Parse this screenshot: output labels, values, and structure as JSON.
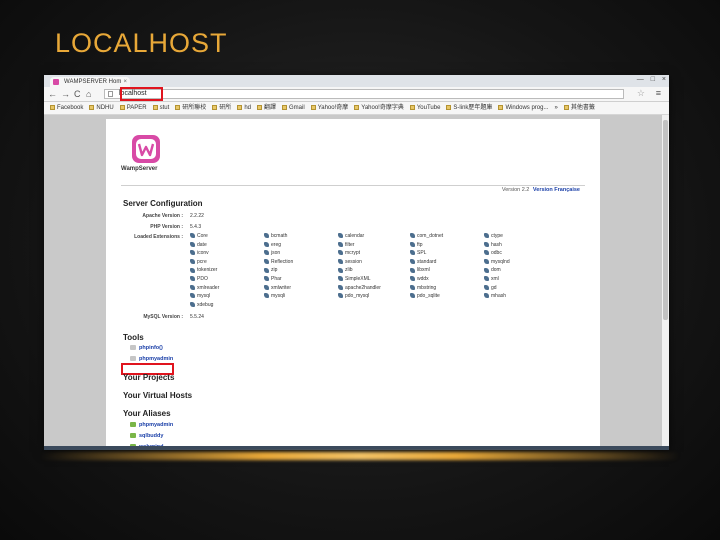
{
  "slide": {
    "title": "LOCALHOST"
  },
  "browser": {
    "tab_title": "WAMPSERVER Hom",
    "tab_close": "×",
    "window_controls": [
      "—",
      "□",
      "×"
    ],
    "nav": {
      "back": "←",
      "forward": "→",
      "reload": "C",
      "home": "⌂"
    },
    "url": "localhost",
    "star_icon": "☆",
    "menu_icon": "≡",
    "bookmarks": [
      "Facebook",
      "NDHU",
      "PAPER",
      "stut",
      "研所聯校",
      "研所",
      "hd",
      "翻譯",
      "Gmail",
      "Yahoo!奇摩",
      "Yahoo!奇摩字典",
      "YouTube",
      "S-link歷年題庫",
      "Windows prog...",
      "»",
      "其他書籤"
    ]
  },
  "wamp": {
    "logo_text": "WampServer",
    "version_text": "Version 2.2",
    "version_link": "Version Française",
    "config_heading": "Server Configuration",
    "apache_label": "Apache Version :",
    "apache_value": "2.2.22",
    "php_label": "PHP Version :",
    "php_value": "5.4.3",
    "ext_label": "Loaded Extensions :",
    "extensions": [
      [
        "Core",
        "date",
        "iconv",
        "pcre",
        "tokenizer",
        "PDO",
        "xmlreader",
        "mysql",
        "xdebug"
      ],
      [
        "bcmath",
        "ereg",
        "json",
        "Reflection",
        "zip",
        "Phar",
        "xmlwriter",
        "mysqli"
      ],
      [
        "calendar",
        "filter",
        "mcrypt",
        "session",
        "zlib",
        "SimpleXML",
        "apache2handler",
        "pdo_mysql"
      ],
      [
        "com_dotnet",
        "ftp",
        "SPL",
        "standard",
        "libxml",
        "wddx",
        "mbstring",
        "pdo_sqlite"
      ],
      [
        "ctype",
        "hash",
        "odbc",
        "mysqlnd",
        "dom",
        "xml",
        "gd",
        "mhash"
      ]
    ],
    "mysql_label": "MySQL Version :",
    "mysql_value": "5.5.24",
    "tools_heading": "Tools",
    "tools": [
      "phpinfo()",
      "phpmyadmin"
    ],
    "projects_heading": "Your Projects",
    "vhosts_heading": "Your Virtual Hosts",
    "aliases_heading": "Your Aliases",
    "aliases": [
      "phpmyadmin",
      "sqlbuddy",
      "webgrind"
    ]
  },
  "colors": {
    "title": "#e8a838",
    "highlight": "#e0141e",
    "link": "#1a3fa8",
    "logo": "#d84aa6"
  }
}
